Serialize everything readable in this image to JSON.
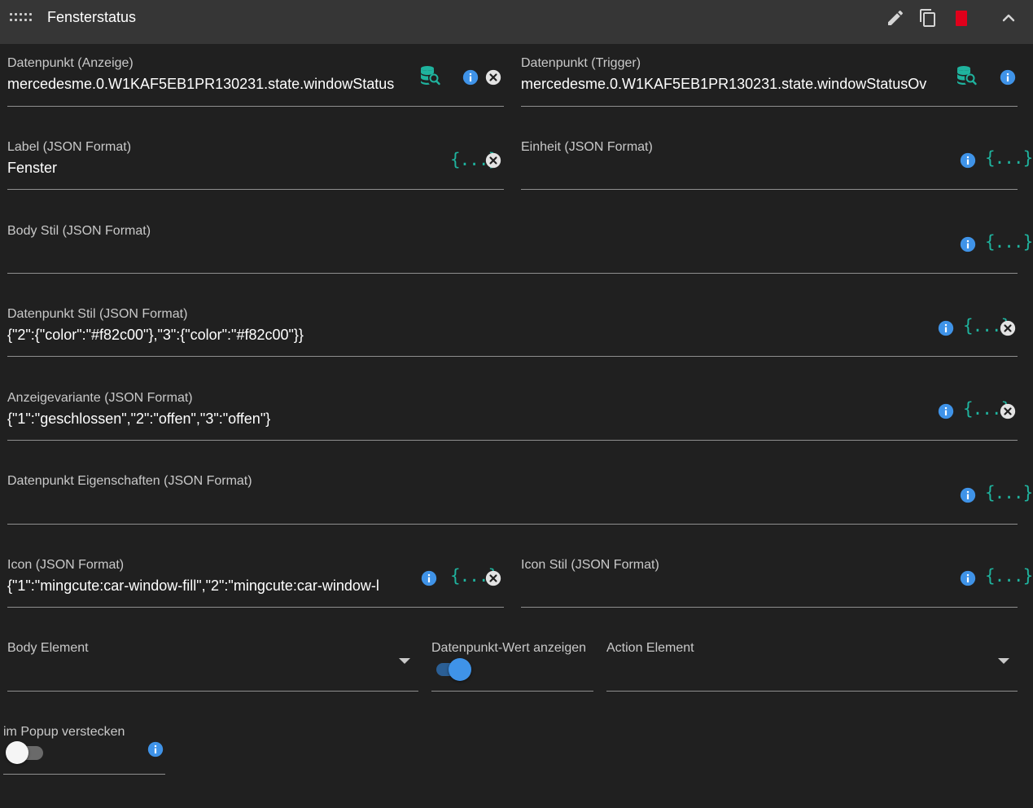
{
  "header": {
    "title": "Fensterstatus",
    "icons": [
      "drag-handle-icon",
      "pencil-icon",
      "copy-icon",
      "delete-icon",
      "chevron-up-icon"
    ],
    "delete_color": "#e0001b"
  },
  "colors": {
    "info": "#3f93e8",
    "json": "#1fb39e",
    "toggle_on": "#3f93e8",
    "background": "#202020",
    "header": "#363636"
  },
  "fields": {
    "dp_display": {
      "label": "Datenpunkt (Anzeige)",
      "value": "mercedesme.0.W1KAF5EB1PR130231.state.windowStatus"
    },
    "dp_trigger": {
      "label": "Datenpunkt (Trigger)",
      "value": "mercedesme.0.W1KAF5EB1PR130231.state.windowStatusOv"
    },
    "label_json": {
      "label": "Label (JSON Format)",
      "value": "Fenster"
    },
    "unit_json": {
      "label": "Einheit (JSON Format)",
      "value": ""
    },
    "body_style": {
      "label": "Body Stil (JSON Format)",
      "value": ""
    },
    "dp_style": {
      "label": "Datenpunkt Stil (JSON Format)",
      "value": "{\"2\":{\"color\":\"#f82c00\"},\"3\":{\"color\":\"#f82c00\"}}"
    },
    "display_variant": {
      "label": "Anzeigevariante (JSON Format)",
      "value": "{\"1\":\"geschlossen\",\"2\":\"offen\",\"3\":\"offen\"}"
    },
    "dp_props": {
      "label": "Datenpunkt Eigenschaften (JSON Format)",
      "value": ""
    },
    "icon_json": {
      "label": "Icon (JSON Format)",
      "value": "{\"1\":\"mingcute:car-window-fill\",\"2\":\"mingcute:car-window-l"
    },
    "icon_style": {
      "label": "Icon Stil (JSON Format)",
      "value": ""
    },
    "body_element": {
      "label": "Body Element",
      "value": ""
    },
    "show_dp_value": {
      "label": "Datenpunkt-Wert anzeigen",
      "checked": true
    },
    "action_element": {
      "label": "Action Element",
      "value": ""
    },
    "hide_in_popup": {
      "label": "im Popup verstecken",
      "checked": false
    }
  },
  "json_glyph": "{...}"
}
